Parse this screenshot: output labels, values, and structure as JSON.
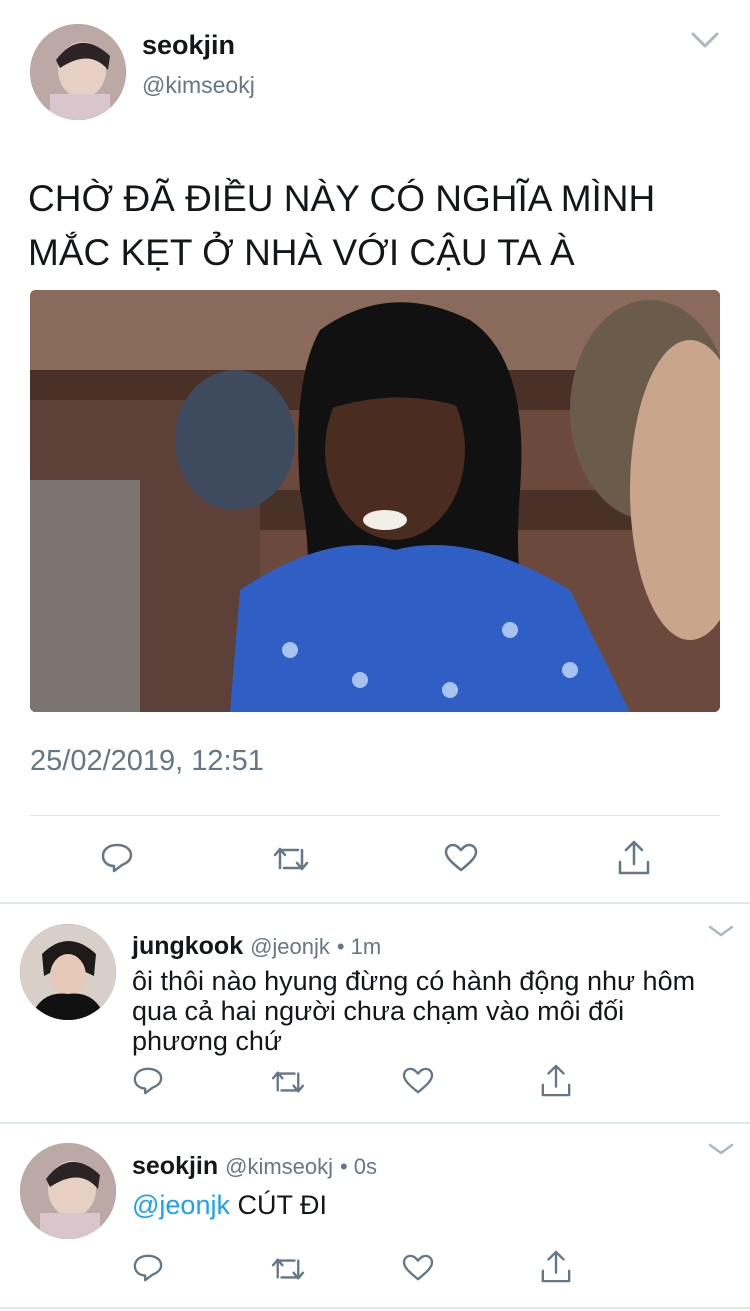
{
  "main_tweet": {
    "display_name": "seokjin",
    "handle": "@kimseokj",
    "text": "CHỜ ĐÃ ĐIỀU NÀY CÓ NGHĨA MÌNH MẮC KẸT Ở NHÀ VỚI CẬU TA À",
    "timestamp": "25/02/2019, 12:51"
  },
  "replies": [
    {
      "display_name": "jungkook",
      "handle": "@jeonjk",
      "time": "• 1m",
      "text": "ôi thôi nào hyung đừng có hành động như hôm qua cả hai người chưa chạm vào môi đối phương chứ"
    },
    {
      "display_name": "seokjin",
      "handle": "@kimseokj",
      "time": "• 0s",
      "mention": "@jeonjk",
      "text": "CÚT ĐI"
    }
  ],
  "icons": {
    "reply": "reply-icon",
    "retweet": "retweet-icon",
    "like": "like-icon",
    "share": "share-icon",
    "menu": "chevron-down-icon"
  },
  "colors": {
    "accent": "#1da1f2",
    "icon": "#657786",
    "divider": "#e1e8ed"
  }
}
